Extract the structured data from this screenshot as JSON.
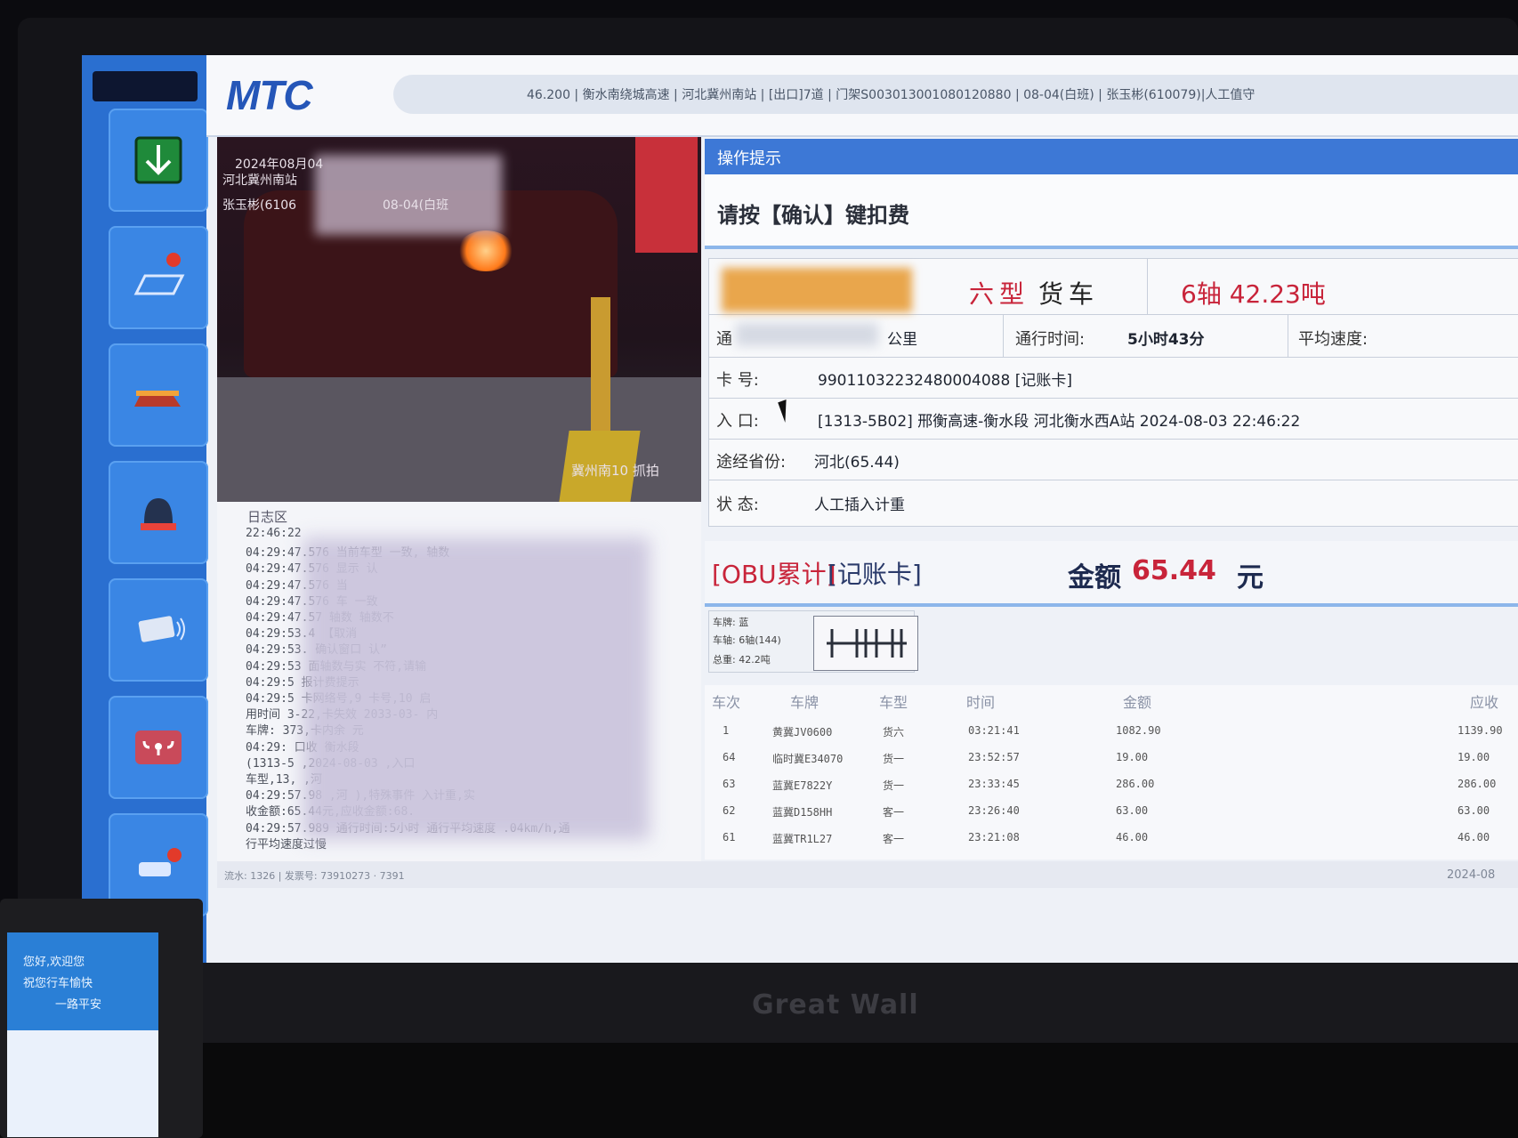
{
  "header": {
    "logo": "MTC",
    "status_line": "46.200 | 衡水南绕城高速 | 河北冀州南站 | [出口]7道 | 门架S003013001080120880 | 08-04(白班) | 张玉彬(610079)|人工值守"
  },
  "camera": {
    "overlay_date": "2024年08月04",
    "overlay_station": "河北冀州南站",
    "overlay_operator": "张玉彬(6106",
    "overlay_shift": "08-04(白班",
    "caption": "冀州南10 抓拍"
  },
  "log": {
    "title": "日志区",
    "lines": [
      "22:46:22",
      "04:29:47.576 当前车型                一致,      轴数",
      "04:29:47.576 显示                 认",
      "04:29:47.576 当",
      "04:29:47.576             车             一致",
      "04:29:47.57          轴数              轴数不",
      "04:29:53.4          【取消",
      "04:29:53.          确认窗口          认”",
      "04:29:53         面轴数与实          不符,请输",
      "04:29:5          报计费提示",
      "04:29:5          卡网络号,9          卡号,10            启",
      "用时间          3-22,卡失效        2033-03-          内",
      "车牌:          373,卡内余          元",
      "04:29:          口收             衡水段",
      "(1313-5           ,2024-08-03           ,入口",
      "车型,13,                      ,河",
      "04:29:57.98         ,河            ),特殊事件         入计重,实",
      "收金额:65.44元,应收金额:68.",
      "04:29:57.989 通行时间:5小时         通行平均速度    .04km/h,通",
      "行平均速度过慢"
    ]
  },
  "op_hint": {
    "title": "操作提示",
    "message": "请按【确认】键扣费"
  },
  "vehicle": {
    "type": "六型",
    "category": "货车",
    "axles_weight": "6轴  42.23吨",
    "distance_label": "通",
    "distance_unit": "公里",
    "travel_time_label": "通行时间:",
    "travel_time": "5小时43分",
    "avg_speed_label": "平均速度:",
    "card_label": "卡    号:",
    "card_no": "99011032232480004088 [记账卡]",
    "entry_label": "入    口:",
    "entry": "[1313-5B02] 邢衡高速-衡水段 河北衡水西A站 2024-08-03 22:46:22",
    "province_label": "途经省份:",
    "province": "河北(65.44)",
    "status_label": "状    态:",
    "status": "人工插入计重"
  },
  "payment": {
    "obu": "[OBU累计]",
    "card": "[记账卡]",
    "amount_label": "金额",
    "amount": "65.44",
    "unit": "元"
  },
  "axle_info": {
    "plate_color": "车牌: 蓝",
    "axles": "车轴: 6轴(144)",
    "weight": "总重: 42.2吨"
  },
  "history": {
    "headers": [
      "车次",
      "车牌",
      "车型",
      "时间",
      "金额",
      "应收"
    ],
    "rows": [
      [
        "1",
        "黄冀JV0600",
        "货六",
        "03:21:41",
        "1082.90",
        "1139.90"
      ],
      [
        "64",
        "临时冀E34070",
        "货一",
        "23:52:57",
        "19.00",
        "19.00"
      ],
      [
        "63",
        "蓝冀E7822Y",
        "货一",
        "23:33:45",
        "286.00",
        "286.00"
      ],
      [
        "62",
        "蓝冀D158HH",
        "客一",
        "23:26:40",
        "63.00",
        "63.00"
      ],
      [
        "61",
        "蓝冀TR1L27",
        "客一",
        "23:21:08",
        "46.00",
        "46.00"
      ]
    ]
  },
  "footer": {
    "left": "流水: 1326 | 发票号: 73910273 · 7391",
    "right_date": "2024-08"
  },
  "monitor": {
    "brand": "Great Wall"
  },
  "phone": {
    "line1": "您好,欢迎您",
    "line2": "祝您行车愉快",
    "line3": "一路平安"
  }
}
